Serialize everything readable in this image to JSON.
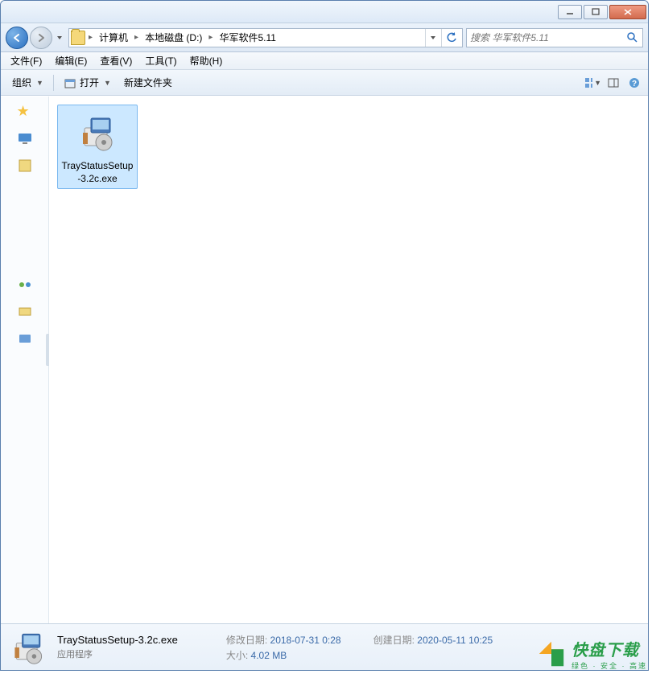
{
  "menubar": {
    "file": "文件(F)",
    "edit": "编辑(E)",
    "view": "查看(V)",
    "tools": "工具(T)",
    "help": "帮助(H)"
  },
  "breadcrumb": {
    "computer": "计算机",
    "drive": "本地磁盘 (D:)",
    "folder": "华军软件5.11"
  },
  "search": {
    "placeholder": "搜索 华军软件5.11"
  },
  "toolbar": {
    "organize": "组织",
    "open": "打开",
    "new_folder": "新建文件夹"
  },
  "file": {
    "name": "TrayStatusSetup-3.2c.exe",
    "type": "应用程序"
  },
  "details": {
    "mod_label": "修改日期:",
    "mod_value": "2018-07-31 0:28",
    "size_label": "大小:",
    "size_value": "4.02 MB",
    "create_label": "创建日期:",
    "create_value": "2020-05-11 10:25"
  },
  "watermark": {
    "main": "快盘下载",
    "sub": "绿色 · 安全 · 高速"
  }
}
